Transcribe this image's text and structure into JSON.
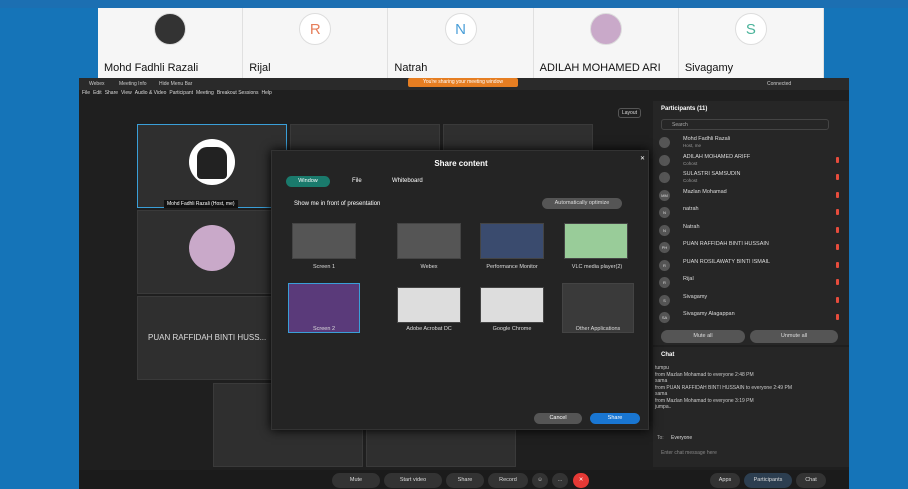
{
  "strip": [
    {
      "name": "Mohd Fadhli Razali",
      "initial": ""
    },
    {
      "name": "Rijal",
      "initial": "R"
    },
    {
      "name": "Natrah",
      "initial": "N"
    },
    {
      "name": "ADILAH MOHAMED ARI",
      "initial": ""
    },
    {
      "name": "Sivagamy",
      "initial": "S"
    }
  ],
  "window": {
    "app": "Webex",
    "tab": "Meeting Info",
    "hide": "Hide Menu Bar",
    "banner": "You're sharing your meeting window",
    "connected": "Connected"
  },
  "menu": [
    "File",
    "Edit",
    "Share",
    "View",
    "Audio & Video",
    "Participant",
    "Meeting",
    "Breakout Sessions",
    "Help"
  ],
  "layout": "Layout",
  "video": {
    "host_label": "Mohd Fadhli Razali (Host, me)",
    "big_name": "PUAN RAFFIDAH BINTI HUSS..."
  },
  "participants": {
    "title": "Participants (11)",
    "search": "Search",
    "list": [
      {
        "n": "Mohd Fadhli Razali",
        "s": "Host, me",
        "i": "",
        "mic": false
      },
      {
        "n": "ADILAH MOHAMED ARIFF",
        "s": "Cohost",
        "i": "",
        "mic": true
      },
      {
        "n": "SULASTRI SAMSUDIN",
        "s": "Cohost",
        "i": "",
        "mic": true
      },
      {
        "n": "Mazlan Mohamad",
        "s": "",
        "i": "MM",
        "mic": true
      },
      {
        "n": "natrah",
        "s": "",
        "i": "N",
        "mic": true
      },
      {
        "n": "Natrah",
        "s": "",
        "i": "N",
        "mic": true
      },
      {
        "n": "PUAN RAFFIDAH BINTI HUSSAIN",
        "s": "",
        "i": "PH",
        "mic": true
      },
      {
        "n": "PUAN ROSILAWATY BINTI ISMAIL",
        "s": "",
        "i": "R",
        "mic": true
      },
      {
        "n": "Rijal",
        "s": "",
        "i": "R",
        "mic": true
      },
      {
        "n": "Sivagamy",
        "s": "",
        "i": "S",
        "mic": true
      },
      {
        "n": "Sivagamy Alagappan",
        "s": "",
        "i": "SA",
        "mic": true
      }
    ],
    "mute_all": "Mute all",
    "unmute_all": "Unmute all"
  },
  "chat": {
    "title": "Chat",
    "lines": [
      "tumpu",
      "from Mazlan Mohamad to everyone   2:48 PM",
      "sama",
      "from PUAN RAFFIDAH BINTI HUSSAIN to everyone   2:49 PM",
      "sama",
      "from Mazlan Mohamad to everyone   3:19 PM",
      "jumpa.."
    ],
    "to": "To:",
    "everyone": "Everyone",
    "placeholder": "Enter chat message here"
  },
  "dialog": {
    "title": "Share content",
    "tabs": [
      "Window",
      "File",
      "Whiteboard"
    ],
    "show_me": "Show me in front of presentation",
    "optimize": "Automatically optimize",
    "items": [
      "Screen 1",
      "Webex",
      "Performance Monitor",
      "VLC media player(2)",
      "Screen 2",
      "Adobe Acrobat DC",
      "Google Chrome",
      "Other Applications"
    ],
    "cancel": "Cancel",
    "share": "Share"
  },
  "controls": [
    "Mute",
    "Start video",
    "Share",
    "Record",
    "Apps",
    "Participants",
    "Chat"
  ]
}
